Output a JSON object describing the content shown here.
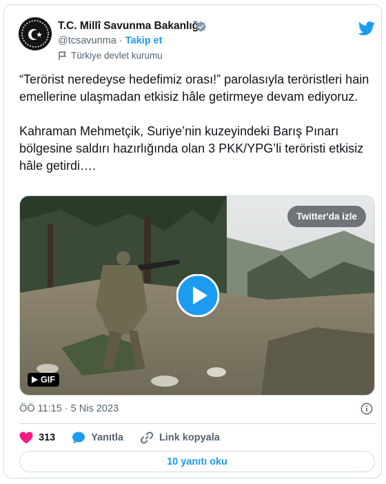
{
  "account": {
    "name": "T.C. Millî Savunma Bakanlığı",
    "handle": "@tcsavunma",
    "separator": "·",
    "follow_label": "Takip et",
    "label": "Türkiye devlet kurumu"
  },
  "tweet": {
    "text": "“Terörist neredeyse hedefimiz orası!” parolasıyla teröristleri hain emellerine ulaşmadan etkisiz hâle getirmeye devam ediyoruz.\n\nKahraman Mehmetçik, Suriye’nin kuzeyindeki Barış Pınarı bölgesine saldırı hazırlığında olan 3 PKK/YPG’li teröristi etkisiz hâle getirdi….",
    "timestamp": "ÖÖ 11:15 · 5 Nis 2023"
  },
  "media": {
    "watch_label": "Twitter'da izle",
    "gif_label": "GIF"
  },
  "actions": {
    "like_count": "313",
    "reply_label": "Yanıtla",
    "copy_link_label": "Link kopyala"
  },
  "read_replies_label": "10 yanıtı oku",
  "colors": {
    "accent": "#1d9bf0",
    "like": "#f91880",
    "secondary_text": "#536471",
    "border": "#cfd9de"
  },
  "icons": [
    "verified-badge-icon",
    "twitter-bird-icon",
    "government-label-icon",
    "play-icon",
    "gif-play-icon",
    "info-icon",
    "heart-icon",
    "reply-icon",
    "link-icon"
  ]
}
